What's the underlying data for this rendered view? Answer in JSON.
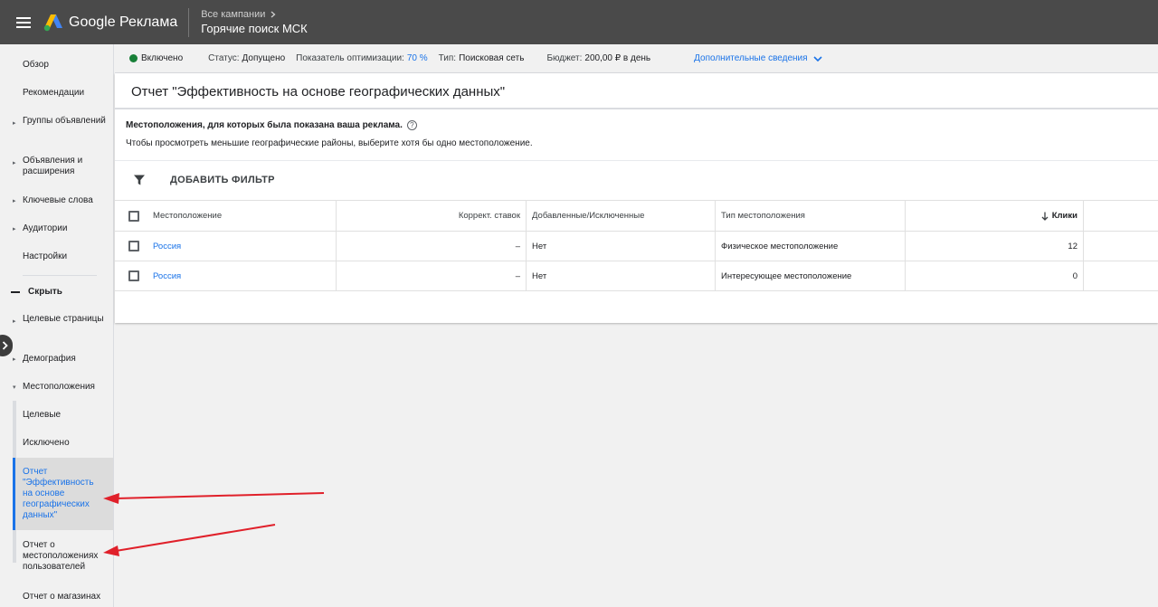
{
  "header": {
    "brand": "Google Реклама",
    "breadcrumb": "Все кампании",
    "campaign_title": "Горячие поиск МСК"
  },
  "sidebar": {
    "items": [
      {
        "label": "Обзор"
      },
      {
        "label": "Рекомендации"
      },
      {
        "label": "Группы объявлений"
      },
      {
        "label": "Объявления и расширения"
      },
      {
        "label": "Ключевые слова"
      },
      {
        "label": "Аудитории"
      },
      {
        "label": "Настройки"
      }
    ],
    "hide_label": "Скрыть",
    "more_items": [
      {
        "label": "Целевые страницы"
      },
      {
        "label": "Демография"
      },
      {
        "label": "Местоположения"
      }
    ],
    "sub_items": [
      {
        "label": "Целевые"
      },
      {
        "label": "Исключено"
      },
      {
        "label": "Отчет \"Эффективность на основе географических данных\""
      },
      {
        "label": "Отчет о местоположениях пользователей"
      },
      {
        "label": "Отчет о магазинах"
      }
    ]
  },
  "status": {
    "state": "Включено",
    "status_label": "Статус:",
    "status_value": "Допущено",
    "opt_label": "Показатель оптимизации:",
    "opt_value": "70 %",
    "type_label": "Тип:",
    "type_value": "Поисковая сеть",
    "budget_label": "Бюджет:",
    "budget_value": "200,00 ₽ в день",
    "more_details": "Дополнительные сведения"
  },
  "report": {
    "title": "Отчет \"Эффективность на основе географических данных\"",
    "info_title": "Местоположения, для которых была показана ваша реклама.",
    "info_text": "Чтобы просмотреть меньшие географические районы, выберите хотя бы одно местоположение.",
    "add_filter": "ДОБАВИТЬ ФИЛЬТР"
  },
  "table": {
    "headers": {
      "location": "Местоположение",
      "bid_adj": "Коррект. ставок",
      "added": "Добавленные/Исключенные",
      "loc_type": "Тип местоположения",
      "clicks": "Клики"
    },
    "rows": [
      {
        "location": "Россия",
        "bid_adj": "–",
        "added": "Нет",
        "loc_type": "Физическое местоположение",
        "clicks": "12"
      },
      {
        "location": "Россия",
        "bid_adj": "–",
        "added": "Нет",
        "loc_type": "Интересующее местоположение",
        "clicks": "0"
      }
    ]
  },
  "colors": {
    "accent": "#1a73e8",
    "topbar": "#4a4a4a",
    "status_green": "#188038",
    "annotation_arrow": "#e0202a"
  }
}
